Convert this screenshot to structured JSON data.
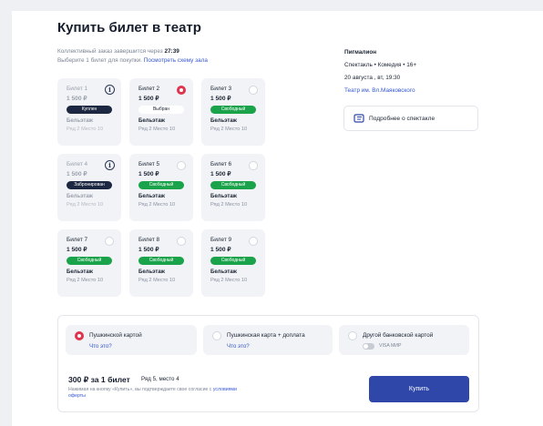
{
  "title": "Купить билет в театр",
  "order": {
    "timer_prefix": "Коллективный заказ завершится через",
    "timer_value": "27:39",
    "choose_prefix": "Выберите 1 билет для покупки.",
    "hall_link": "Посмотреть схему зала"
  },
  "tickets": [
    {
      "title": "Билет 1",
      "price": "1 500 ₽",
      "status": "Куплен",
      "zone": "Бельэтаж",
      "row": "Ряд 2",
      "seat": "Место 10"
    },
    {
      "title": "Билет 2",
      "price": "1 500 ₽",
      "status": "Выбран",
      "zone": "Бельэтаж",
      "row": "Ряд 2",
      "seat": "Место 10"
    },
    {
      "title": "Билет 3",
      "price": "1 500 ₽",
      "status": "Свободный",
      "zone": "Бельэтаж",
      "row": "Ряд 2",
      "seat": "Место 10"
    },
    {
      "title": "Билет 4",
      "price": "1 500 ₽",
      "status": "Забронирован",
      "zone": "Бельэтаж",
      "row": "Ряд 2",
      "seat": "Место 10"
    },
    {
      "title": "Билет 5",
      "price": "1 500 ₽",
      "status": "Свободный",
      "zone": "Бельэтаж",
      "row": "Ряд 2",
      "seat": "Место 10"
    },
    {
      "title": "Билет 6",
      "price": "1 500 ₽",
      "status": "Свободный",
      "zone": "Бельэтаж",
      "row": "Ряд 2",
      "seat": "Место 10"
    },
    {
      "title": "Билет 7",
      "price": "1 500 ₽",
      "status": "Свободный",
      "zone": "Бельэтаж",
      "row": "Ряд 2",
      "seat": "Место 10"
    },
    {
      "title": "Билет 8",
      "price": "1 500 ₽",
      "status": "Свободный",
      "zone": "Бельэтаж",
      "row": "Ряд 2",
      "seat": "Место 10"
    },
    {
      "title": "Билет 9",
      "price": "1 500 ₽",
      "status": "Свободный",
      "zone": "Бельэтаж",
      "row": "Ряд 2",
      "seat": "Место 10"
    }
  ],
  "show": {
    "name": "Пигмалион",
    "genre": "Спектакль • Комедия • 16+",
    "datetime": "20 августа , вт, 19:30",
    "theatre": "Театр им. Вл.Маяковского",
    "more_button": "Подробнее о спектакле"
  },
  "payment": {
    "options": [
      {
        "label": "Пушкинской картой",
        "sub": "Что это?"
      },
      {
        "label": "Пушкинская карта + доплата",
        "sub": "Что это?"
      },
      {
        "label": "Другой банковской картой",
        "sub": "VISA  МИР"
      }
    ],
    "price": "300 ₽ за 1 билет",
    "seat_info": "Ряд 5, место 4",
    "terms_text": "Нажимая на кнопку «Купить», вы подтверждаете свое согласие с",
    "terms_link": "условиями оферты",
    "buy_button": "Купить"
  },
  "colors": {
    "accent": "#2e47a8",
    "free": "#1aa34a",
    "selected": "#e0334d",
    "link": "#3457d5"
  }
}
